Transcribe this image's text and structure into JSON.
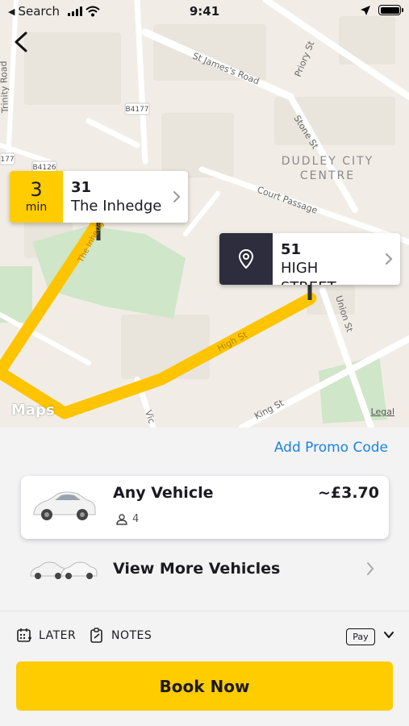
{
  "status_bar": {
    "back_app": "Search",
    "time": "9:41",
    "icons": [
      "signal-icon",
      "wifi-icon",
      "location-arrow-icon",
      "battery-icon"
    ]
  },
  "map": {
    "streets": {
      "trinity_road": "Trinity Road",
      "st_jamess_road": "St James's Road",
      "priory_st": "Priory St",
      "b4177": "B4177",
      "b4126": "B4126",
      "r177": "177",
      "stone_st": "Stone St",
      "court_passage": "Court Passage",
      "high_st": "High St",
      "union_st": "Union St",
      "king_st": "King St",
      "vic": "Vic",
      "the_inhedge": "The Inhedge"
    },
    "area_label_1": "DUDLEY CITY",
    "area_label_2": "CENTRE",
    "maps_brand": "Maps",
    "legal": "Legal",
    "route_color": "#ffc400"
  },
  "pickup": {
    "eta_value": "3",
    "eta_unit": "min",
    "number": "31",
    "street": "The Inhedge",
    "color": "#ffcc00"
  },
  "dropoff": {
    "number": "51",
    "street": "HIGH STREET",
    "color": "#2e2d3d",
    "icon": "location-pin-icon"
  },
  "sheet": {
    "promo_label": "Add Promo Code",
    "promo_color": "#1d83e0",
    "vehicle": {
      "name": "Any Vehicle",
      "seats": "4",
      "price": "~£3.70"
    },
    "more_vehicles_label": "View More Vehicles",
    "options": {
      "later_label": "LATER",
      "notes_label": "NOTES",
      "payment_label": "Pay"
    },
    "book_label": "Book Now",
    "accent": "#ffcc00"
  }
}
